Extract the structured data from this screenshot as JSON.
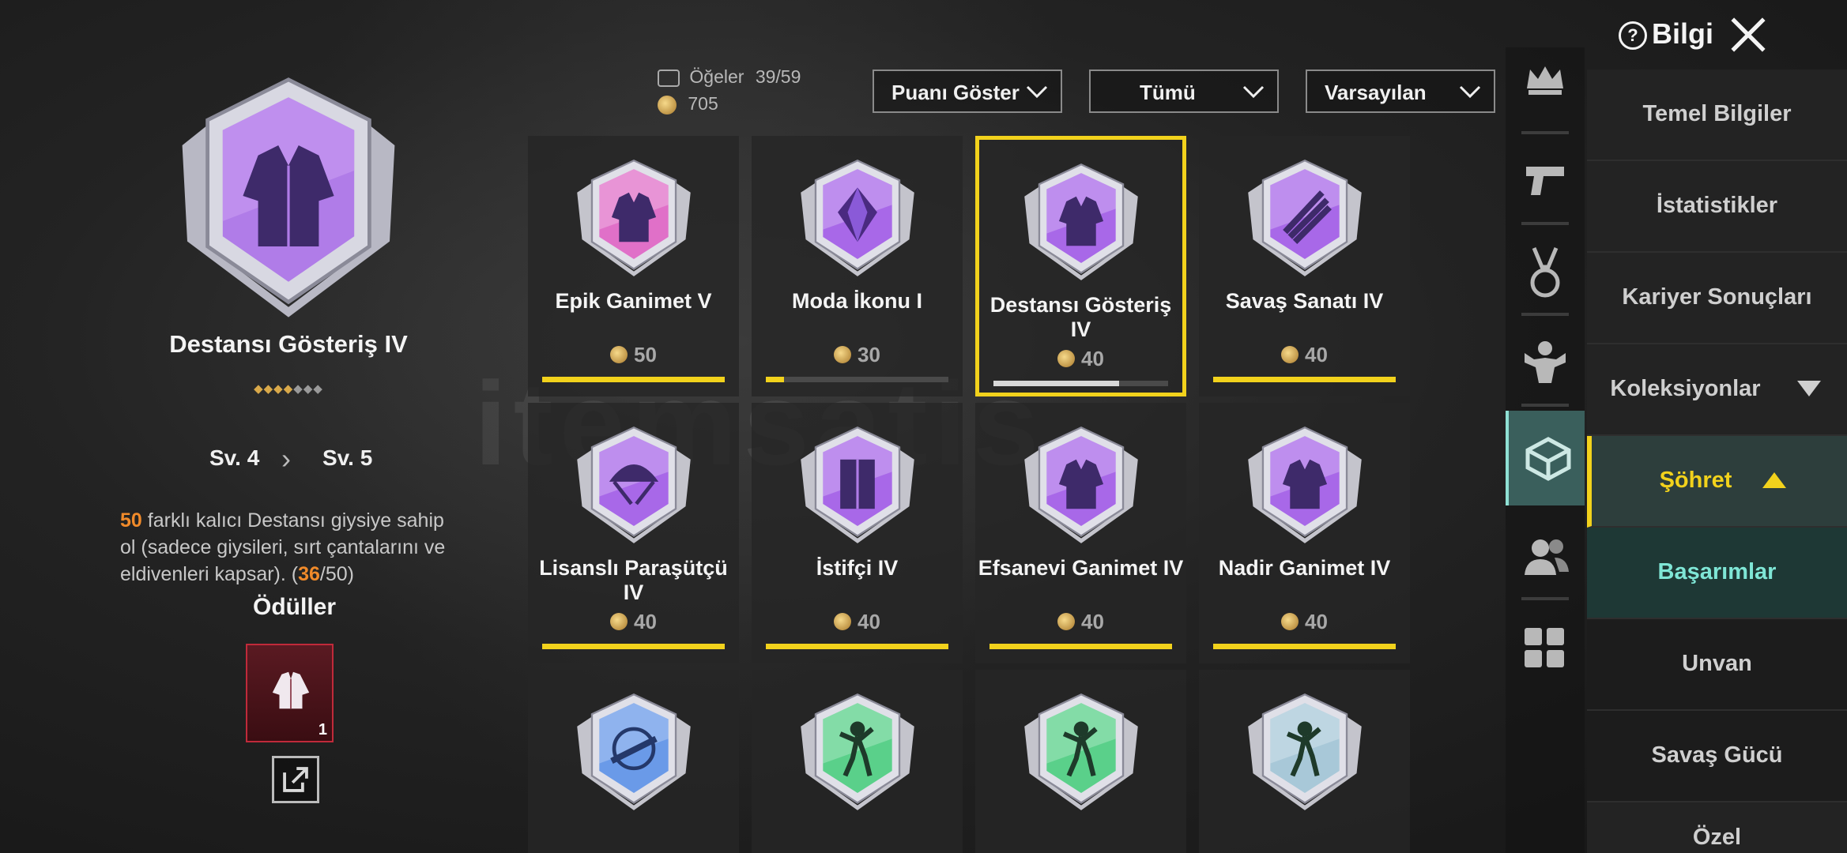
{
  "header": {
    "info_label": "Bilgi",
    "items_label": "Öğeler",
    "items_count": "39/59",
    "points_total": "705"
  },
  "filters": {
    "points": "Puanı Göster",
    "category": "Tümü",
    "sort": "Varsayılan"
  },
  "detail": {
    "title": "Destansı Gösteriş IV",
    "stars_filled": 4,
    "stars_total": 7,
    "level_current": "Sv. 4",
    "level_next": "Sv. 5",
    "desc_count": "50",
    "desc_text": "farklı kalıcı Destansı giysiye sahip ol (sadece giysileri, sırt çantalarını ve eldivenleri kapsar). (",
    "progress_current": "36",
    "progress_sep": "/",
    "progress_total": "50",
    "progress_close": ")",
    "rewards_title": "Ödüller",
    "reward_count": "1"
  },
  "cards": [
    {
      "name": "Epik Ganimet V",
      "points": "50",
      "progress": 1.0,
      "color": "#e070c8",
      "icon": "jacket-icon"
    },
    {
      "name": "Moda İkonu I",
      "points": "30",
      "progress": 0.1,
      "color": "#a868e8",
      "icon": "diamond-icon"
    },
    {
      "name": "Destansı Gösteriş IV",
      "points": "40",
      "progress": 0.72,
      "color": "#a868e8",
      "icon": "jacket-icon"
    },
    {
      "name": "Savaş Sanatı IV",
      "points": "40",
      "progress": 1.0,
      "color": "#a868e8",
      "icon": "rifles-icon"
    },
    {
      "name": "Lisanslı Paraşütçü IV",
      "points": "40",
      "progress": 1.0,
      "color": "#a868e8",
      "icon": "parachute-icon"
    },
    {
      "name": "İstifçi IV",
      "points": "40",
      "progress": 1.0,
      "color": "#a868e8",
      "icon": "locker-icon"
    },
    {
      "name": "Efsanevi Ganimet IV",
      "points": "40",
      "progress": 1.0,
      "color": "#a868e8",
      "icon": "jacket-icon"
    },
    {
      "name": "Nadir Ganimet IV",
      "points": "40",
      "progress": 1.0,
      "color": "#a868e8",
      "icon": "jacket-icon"
    },
    {
      "name": "",
      "points": "",
      "progress": 0,
      "color": "#6a9ae8",
      "icon": "crosshair-rifle-icon"
    },
    {
      "name": "",
      "points": "",
      "progress": 0,
      "color": "#5ad08a",
      "icon": "dancer-icon"
    },
    {
      "name": "",
      "points": "",
      "progress": 0,
      "color": "#5ad08a",
      "icon": "dancer-icon"
    },
    {
      "name": "",
      "points": "",
      "progress": 0,
      "color": "#a8c8d8",
      "icon": "dancer-icon"
    }
  ],
  "menu": {
    "basic": "Temel Bilgiler",
    "stats": "İstatistikler",
    "career": "Kariyer Sonuçları",
    "collections": "Koleksiyonlar",
    "fame": "Şöhret",
    "achievements": "Başarımlar",
    "title": "Unvan",
    "power": "Savaş Gücü",
    "partial": "Özel"
  },
  "watermark": "itemsatis",
  "colors": {
    "accent_yellow": "#f2d21c",
    "accent_teal": "#7fe6d6",
    "orange": "#f08a2a"
  }
}
